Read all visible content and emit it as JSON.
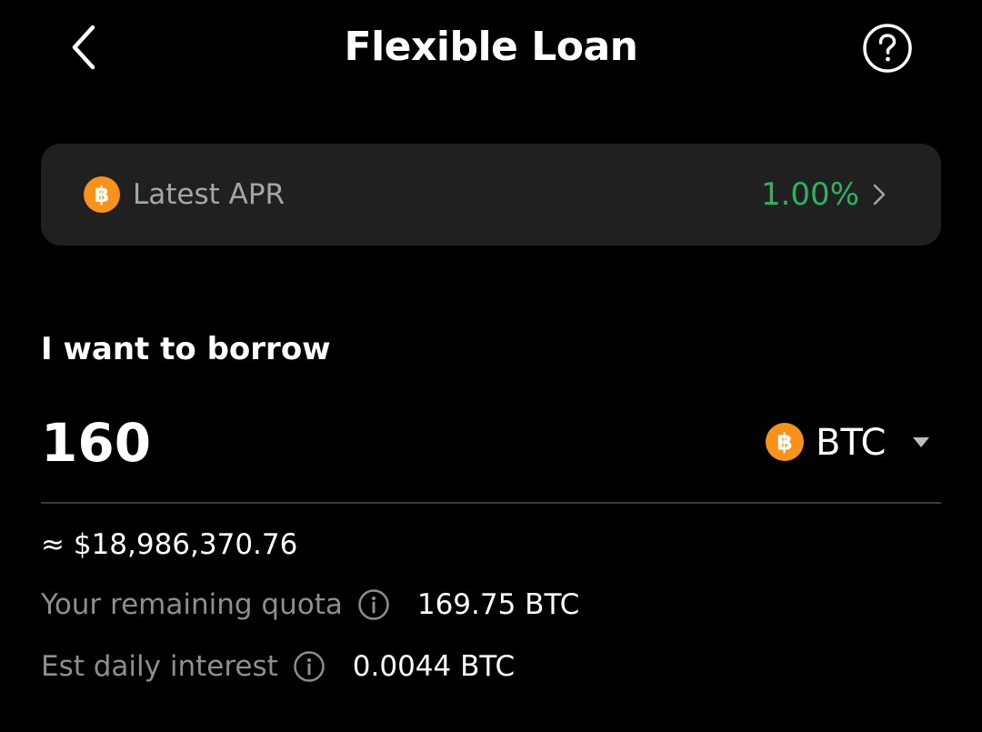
{
  "header": {
    "title": "Flexible Loan",
    "back_icon": "chevron-left-icon",
    "help_icon": "question-circle-icon"
  },
  "apr_card": {
    "coin_icon": "bitcoin-icon",
    "label": "Latest APR",
    "value": "1.00%",
    "value_color": "#2fb163",
    "chevron_icon": "chevron-right-icon"
  },
  "borrow": {
    "label": "I want to borrow",
    "amount": "160",
    "coin": "BTC",
    "coin_icon": "bitcoin-icon",
    "coin_color": "#f7931a",
    "caret_icon": "caret-down-icon",
    "usd_equivalent": "≈ $18,986,370.76"
  },
  "details": {
    "quota_label": "Your remaining quota",
    "quota_value": "169.75 BTC",
    "interest_label": "Est daily interest",
    "interest_value": "0.0044 BTC",
    "info_icon": "info-icon"
  },
  "colors": {
    "background": "#000000",
    "card": "#202020",
    "positive": "#2fb163",
    "muted_text": "#8e8e8e",
    "bitcoin_orange": "#f7931a"
  }
}
